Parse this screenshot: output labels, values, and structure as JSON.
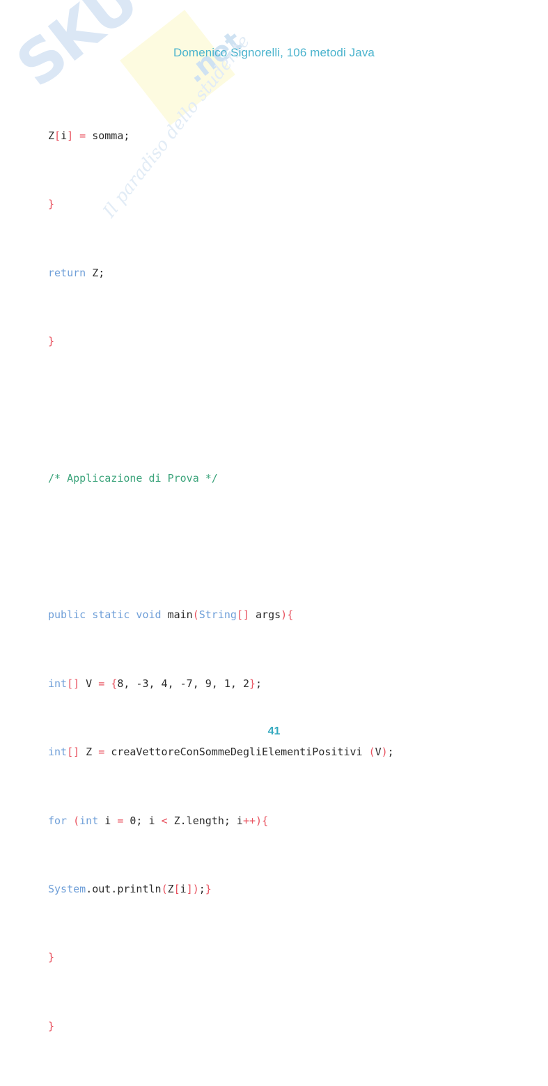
{
  "document": {
    "header_title": "Domenico Signorelli, 106 metodi Java",
    "page_number": "41",
    "header_color": "#4ab3cd",
    "page_number_color": "#34a9bf"
  },
  "watermark": {
    "brand": "SKUOLA",
    "domain": ".net",
    "tagline": "Il paradiso dello studente",
    "brand_color": "#dbe7f5",
    "box_color": "#fdfbe0"
  },
  "code": {
    "language": "java",
    "colors": {
      "keyword": "#6f9fd8",
      "punctuation": "#e8525f",
      "plain": "#2b2b2b",
      "comment": "#3aa37a"
    },
    "lines": [
      {
        "id": "l1",
        "text": "Z[i] = somma;"
      },
      {
        "id": "l2",
        "text": "}"
      },
      {
        "id": "l3",
        "text": "return Z;"
      },
      {
        "id": "l4",
        "text": "}"
      },
      {
        "id": "l5",
        "text": ""
      },
      {
        "id": "l6",
        "text": "/* Applicazione di Prova */"
      },
      {
        "id": "l7",
        "text": ""
      },
      {
        "id": "l8",
        "text": "public static void main(String[] args){"
      },
      {
        "id": "l9",
        "text": "int[] V = {8, -3, 4, -7, 9, 1, 2};"
      },
      {
        "id": "l10",
        "text": "int[] Z = creaVettoreConSommeDegliElementiPositivi (V);"
      },
      {
        "id": "l11",
        "text": "for (int i = 0; i < Z.length; i++){"
      },
      {
        "id": "l12",
        "text": "System.out.println(Z[i]);}"
      },
      {
        "id": "l13",
        "text": "}"
      },
      {
        "id": "l14",
        "text": "}"
      }
    ],
    "array_literal": {
      "variable": "V",
      "values": [
        8,
        -3,
        4,
        -7,
        9,
        1,
        2
      ]
    },
    "method_called": "creaVettoreConSommeDegliElementiPositivi",
    "comment_text": "/* Applicazione di Prova */"
  }
}
